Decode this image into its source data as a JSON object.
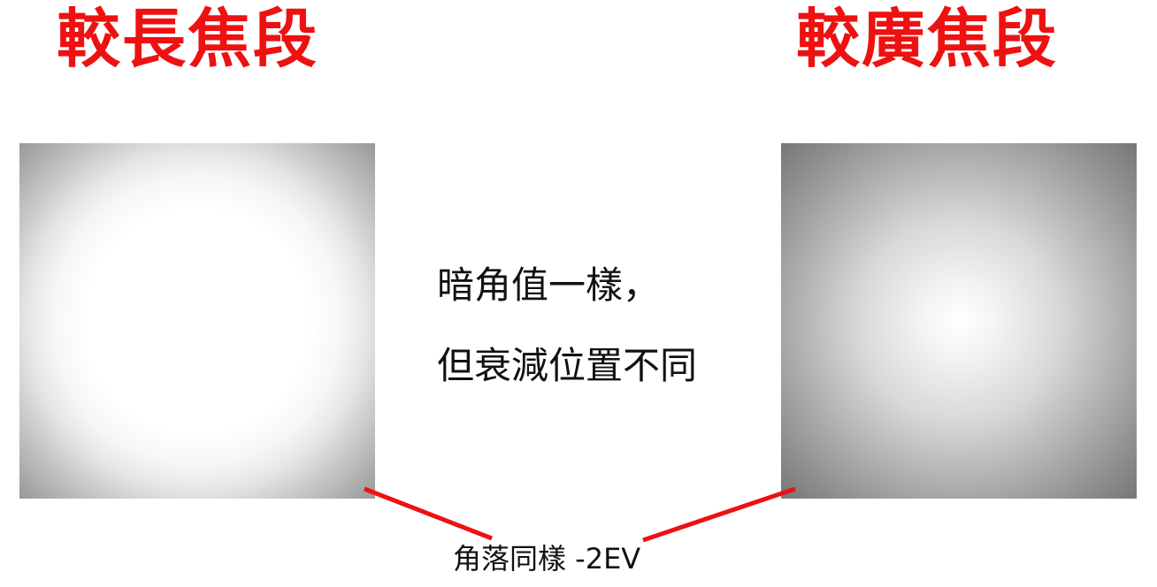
{
  "titles": {
    "left": "較長焦段",
    "right": "較廣焦段"
  },
  "caption": {
    "line1": "暗角值一樣，",
    "line2": "但衰減位置不同"
  },
  "corner_note": "角落同樣 -2EV",
  "colors": {
    "title": "#ee1111",
    "connector": "#ee1111",
    "text": "#111111"
  }
}
